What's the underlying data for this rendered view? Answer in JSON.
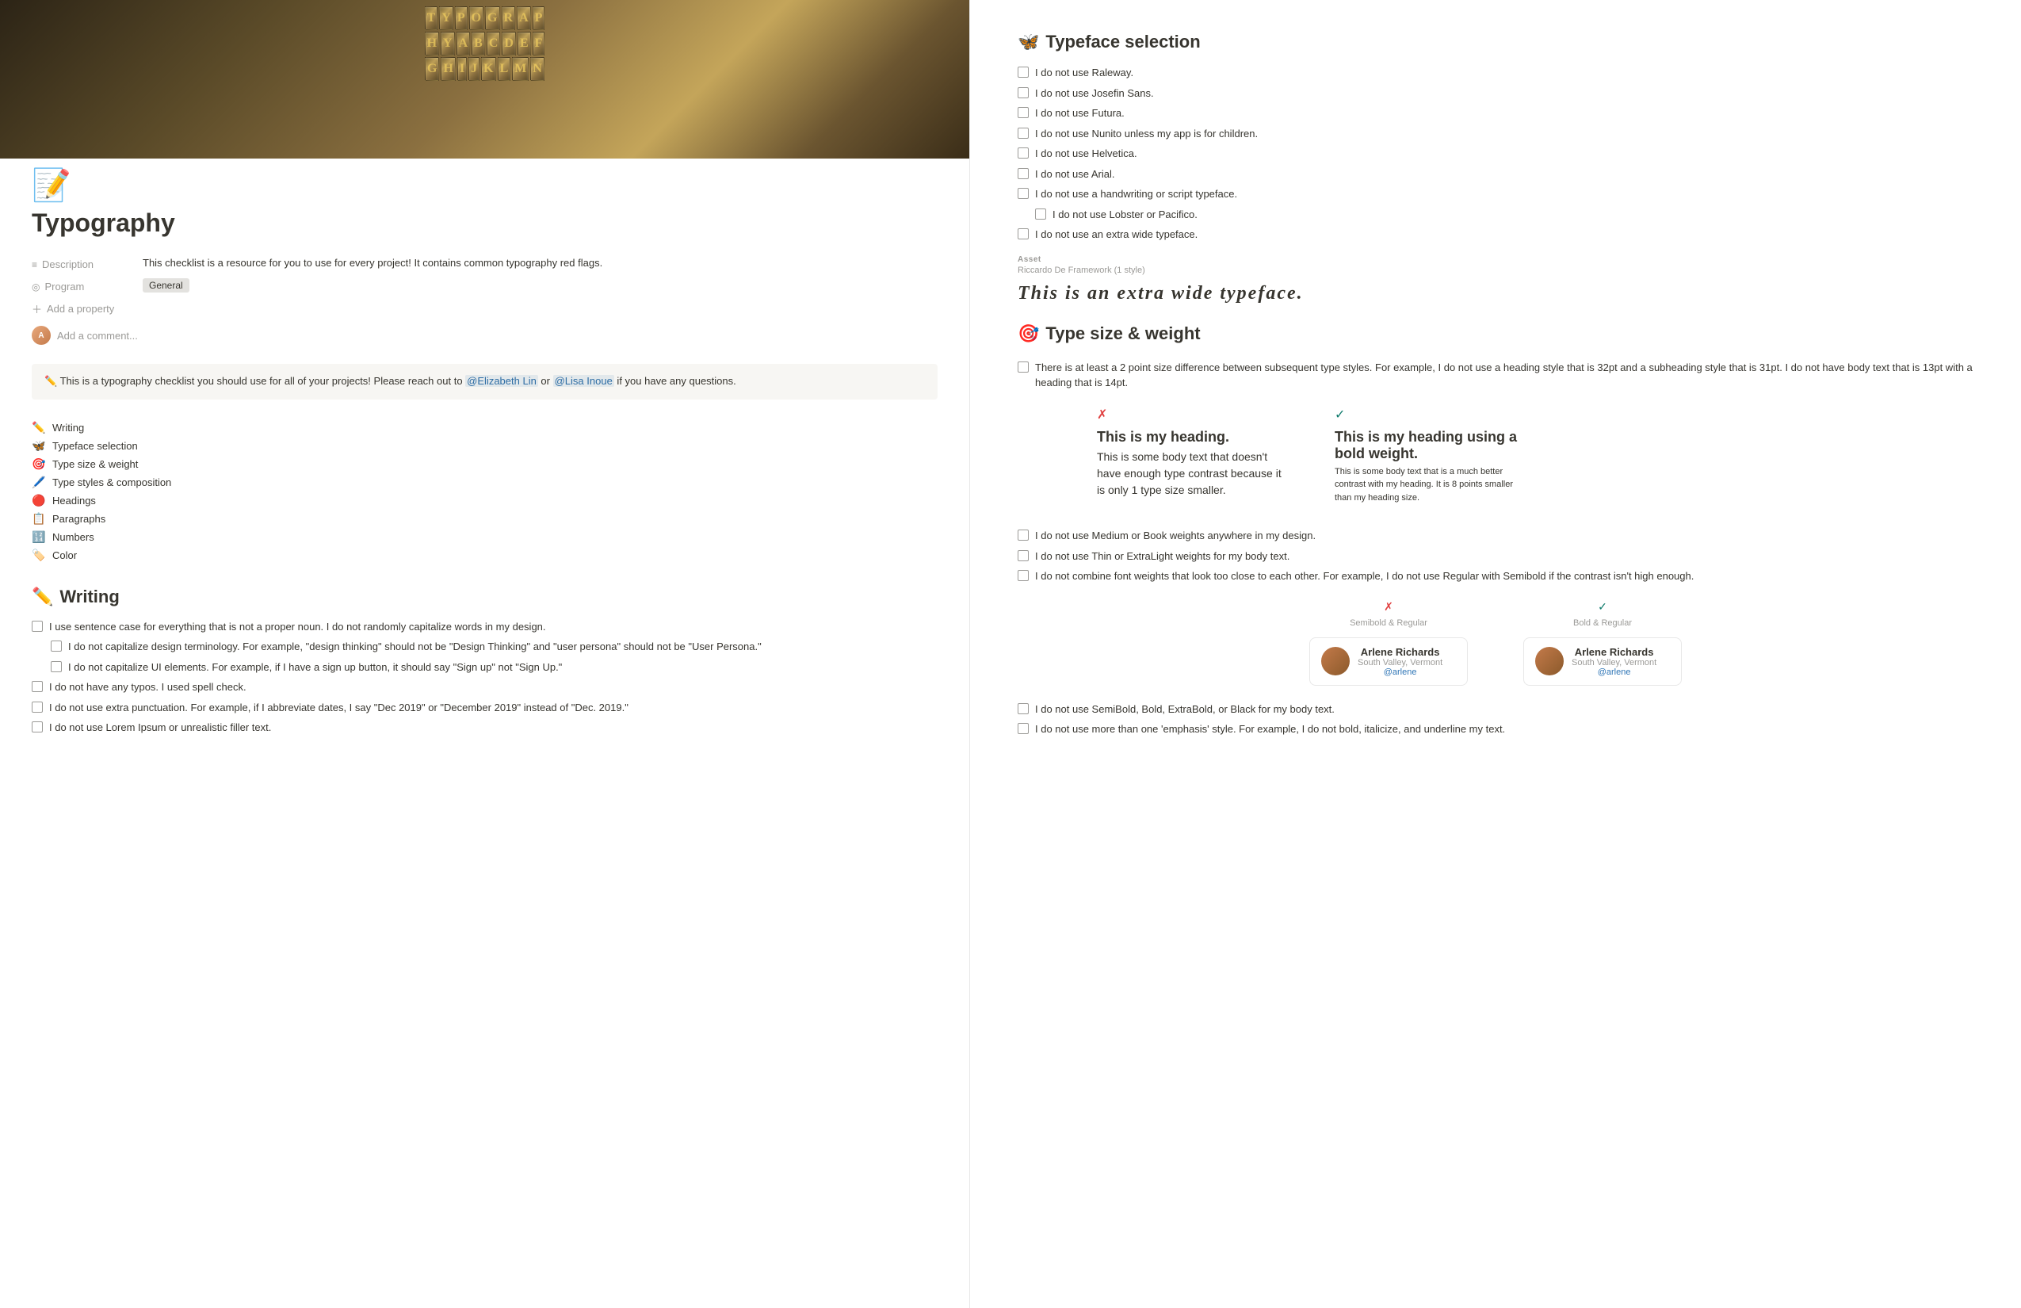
{
  "left": {
    "page_icon": "📝",
    "page_title": "Typography",
    "description_label": "Description",
    "description_icon": "≡",
    "description_text": "This checklist is a resource for you to use for every project! It contains common typography red flags.",
    "program_label": "Program",
    "program_icon": "◎",
    "program_value": "General",
    "add_property": "Add a property",
    "add_comment_placeholder": "Add a comment...",
    "callout_text": "✏️ This is a typography checklist you should use for all of your projects! Please reach out to @Elizabeth Lin or @Lisa Inoue if you have any questions.",
    "toc_items": [
      {
        "icon": "✏️",
        "label": "Writing"
      },
      {
        "icon": "🦋",
        "label": "Typeface selection"
      },
      {
        "icon": "🎯",
        "label": "Type size & weight"
      },
      {
        "icon": "🖊️",
        "label": "Type styles & composition"
      },
      {
        "icon": "🔴",
        "label": "Headings"
      },
      {
        "icon": "📋",
        "label": "Paragraphs"
      },
      {
        "icon": "🔢",
        "label": "Numbers"
      },
      {
        "icon": "🏷️",
        "label": "Color"
      }
    ],
    "writing_section": {
      "icon": "✏️",
      "title": "Writing",
      "items": [
        {
          "text": "I use sentence case for everything that is not a proper noun. I do not randomly capitalize words in my design.",
          "indent": 0
        },
        {
          "text": "I do not capitalize design terminology. For example, \"design thinking\" should not be \"Design Thinking\" and \"user persona\" should not be \"User Persona.\"",
          "indent": 1
        },
        {
          "text": "I do not capitalize UI elements. For example, if I have a sign up button, it should say \"Sign up\" not \"Sign Up.\"",
          "indent": 1
        },
        {
          "text": "I do not have any typos. I used spell check.",
          "indent": 0
        },
        {
          "text": "I do not use extra punctuation. For example, if I abbreviate dates, I say \"Dec 2019\" or \"December 2019\" instead of \"Dec. 2019.\"",
          "indent": 0
        },
        {
          "text": "I do not use Lorem Ipsum or unrealistic filler text.",
          "indent": 0
        }
      ]
    }
  },
  "right": {
    "typeface_section": {
      "icon": "🦋",
      "title": "Typeface selection",
      "items": [
        {
          "text": "I do not use Raleway.",
          "indent": 0
        },
        {
          "text": "I do not use Josefin Sans.",
          "indent": 0
        },
        {
          "text": "I do not use Futura.",
          "indent": 0
        },
        {
          "text": "I do not use Nunito unless my app is for children.",
          "indent": 0
        },
        {
          "text": "I do not use Helvetica.",
          "indent": 0
        },
        {
          "text": "I do not use Arial.",
          "indent": 0
        },
        {
          "text": "I do not use a handwriting or script typeface.",
          "indent": 0
        },
        {
          "text": "I do not use Lobster or Pacifico.",
          "indent": 1
        },
        {
          "text": "I do not use an extra wide typeface.",
          "indent": 0
        }
      ],
      "asset_label": "Asset",
      "asset_sub": "Riccardo De Framework (1 style)",
      "demo_text": "This is an extra wide typeface."
    },
    "type_size_section": {
      "icon": "🎯",
      "title": "Type size & weight",
      "main_item": "There is at least a 2 point size difference between subsequent type styles. For example, I do not use a heading style that is 32pt and a subheading style that is 31pt. I do not have body text that is 13pt with a heading that is 14pt.",
      "bad_example": {
        "status_icon": "✗",
        "heading": "This is my heading.",
        "body": "This is some body text that doesn't have enough type contrast because it is only 1 type size smaller."
      },
      "good_example": {
        "status_icon": "✓",
        "heading": "This is my heading using a bold weight.",
        "body": "This is some body text that is a much better contrast with my heading. It is 8 points smaller than my heading size."
      },
      "additional_items": [
        "I do not use Medium or Book weights anywhere in my design.",
        "I do not use Thin or ExtraLight weights for my body text.",
        "I do not combine font weights that look too close to each other. For example, I do not use Regular with Semibold if the contrast isn't high enough."
      ],
      "bad_weight_label": "Semibold & Regular",
      "good_weight_label": "Bold & Regular",
      "profile": {
        "name": "Arlene Richards",
        "location": "South Valley, Vermont",
        "handle": "@arlene"
      },
      "bottom_items": [
        "I do not use SemiBold, Bold, ExtraBold, or Black for my body text.",
        "I do not use more than one 'emphasis' style. For example, I do not bold, italicize, and underline my text."
      ]
    }
  }
}
